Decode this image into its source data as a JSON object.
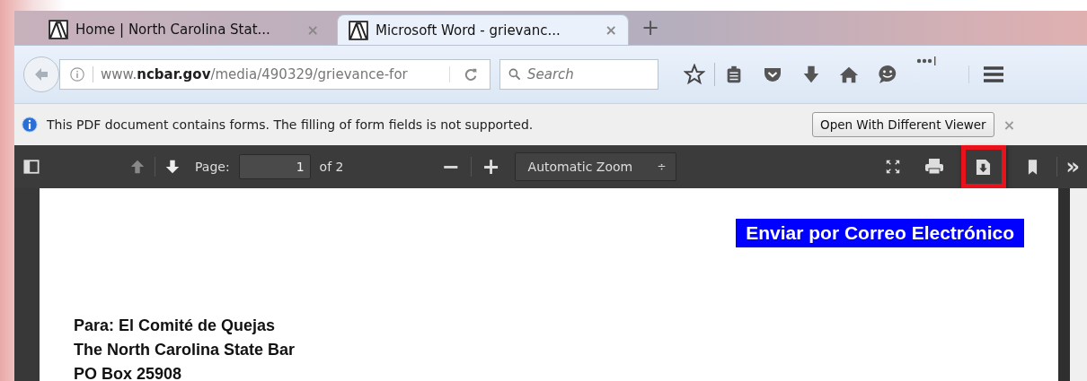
{
  "tabs": [
    {
      "title": "Home | North Carolina Stat...",
      "close": "×",
      "selected": false
    },
    {
      "title": "Microsoft Word - grievanc...",
      "close": "×",
      "selected": true
    }
  ],
  "new_tab": "+",
  "address_bar": {
    "url": "www.**ncbar.gov**/media/490329/grievance-for"
  },
  "search": {
    "placeholder": "Search"
  },
  "notification": {
    "message": "This PDF document contains forms. The filling of form fields is not supported.",
    "button": "Open With Different Viewer",
    "close": "×"
  },
  "pdf_toolbar": {
    "page_label": "Page:",
    "page_value": "1",
    "page_count": "of 2",
    "zoom_out": "−",
    "zoom_in": "+",
    "zoom_select": "Automatic Zoom",
    "zoom_caret": "÷",
    "more": "»",
    "tools": [
      {
        "kind": "fullscreen",
        "highlighted": false
      },
      {
        "kind": "print",
        "highlighted": false
      },
      {
        "kind": "download",
        "highlighted": true
      },
      {
        "kind": "bookmark",
        "highlighted": false
      }
    ]
  },
  "document": {
    "email_button": "Enviar por Correo Electrónico",
    "address_lines": [
      "Para: El Comité de Quejas",
      "The North Carolina State Bar",
      "PO Box 25908"
    ]
  }
}
